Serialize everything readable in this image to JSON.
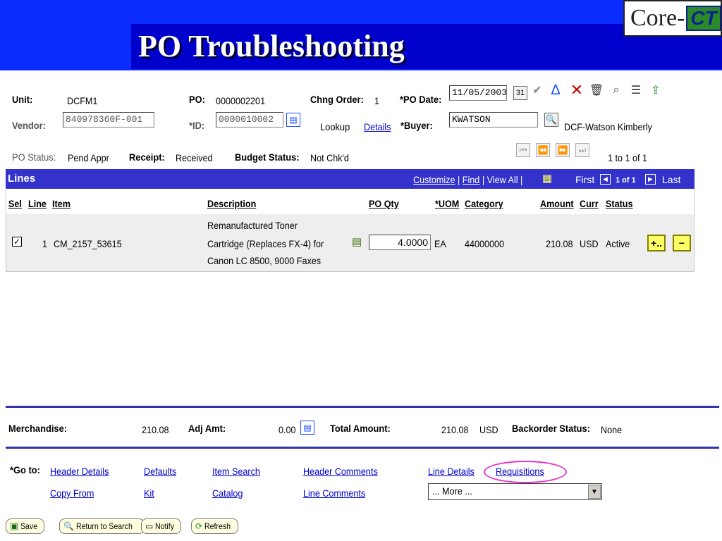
{
  "slide": {
    "title": "PO Troubleshooting",
    "logo_text": "Core-",
    "logo_badge": "CT"
  },
  "header": {
    "unit_label": "Unit:",
    "unit_value": "DCFM1",
    "po_label": "PO:",
    "po_value": "0000002201",
    "chng_order_label": "Chng Order:",
    "chng_order_value": "1",
    "po_date_label": "*PO Date:",
    "po_date_value": "11/05/2003",
    "vendor_label": "Vendor:",
    "vendor_value": "840978360F-001",
    "id_label": "*ID:",
    "id_value": "0000010002",
    "lookup_label": "Lookup",
    "details_link": "Details",
    "buyer_label": "*Buyer:",
    "buyer_value": "KWATSON",
    "buyer_name": "DCF-Watson Kimberly",
    "po_status_label": "PO Status:",
    "po_status_value": "Pend Appr",
    "receipt_label": "Receipt:",
    "receipt_value": "Received",
    "budget_status_label": "Budget Status:",
    "budget_status_value": "Not Chk'd",
    "page_count": "1 to 1 of 1"
  },
  "lines_grid": {
    "title": "Lines",
    "customize": "Customize",
    "find": "Find",
    "view_all": "View All",
    "sep": "|",
    "first": "First",
    "range": "1 of 1",
    "last": "Last",
    "columns": {
      "sel": "Sel",
      "line": "Line",
      "item": "Item",
      "description": "Description",
      "po_qty": "PO Qty",
      "uom": "*UOM",
      "category": "Category",
      "amount": "Amount",
      "curr": "Curr",
      "status": "Status"
    },
    "row": {
      "selected": true,
      "line": "1",
      "item": "CM_2157_53615",
      "description_line1": "Remanufactured Toner",
      "description_line2": "Cartridge (Replaces FX-4) for",
      "description_line3": "Canon LC 8500, 9000 Faxes",
      "po_qty": "4.0000",
      "uom": "EA",
      "category": "44000000",
      "amount": "210.08",
      "curr": "USD",
      "status": "Active",
      "add_label": "+..",
      "remove_label": "−"
    }
  },
  "totals": {
    "merchandise_label": "Merchandise:",
    "merchandise_value": "210.08",
    "adj_amt_label": "Adj Amt:",
    "adj_amt_value": "0.00",
    "total_amount_label": "Total Amount:",
    "total_amount_value": "210.08",
    "total_currency": "USD",
    "backorder_label": "Backorder Status:",
    "backorder_value": "None"
  },
  "goto": {
    "label": "*Go to:",
    "links_row1": [
      "Header Details",
      "Defaults",
      "Item Search",
      "Header Comments",
      "Line Details",
      "Requisitions"
    ],
    "links_row2": [
      "Copy From",
      "Kit",
      "Catalog",
      "Line Comments"
    ],
    "more_select": "... More ..."
  },
  "toolbar": {
    "save": "Save",
    "return_to_search": "Return to Search",
    "notify": "Notify",
    "refresh": "Refresh"
  },
  "colors": {
    "banner_blue": "#0b2cff",
    "grid_header": "#3333cc",
    "highlight_oval": "#e633cc",
    "link": "#0000cc"
  }
}
